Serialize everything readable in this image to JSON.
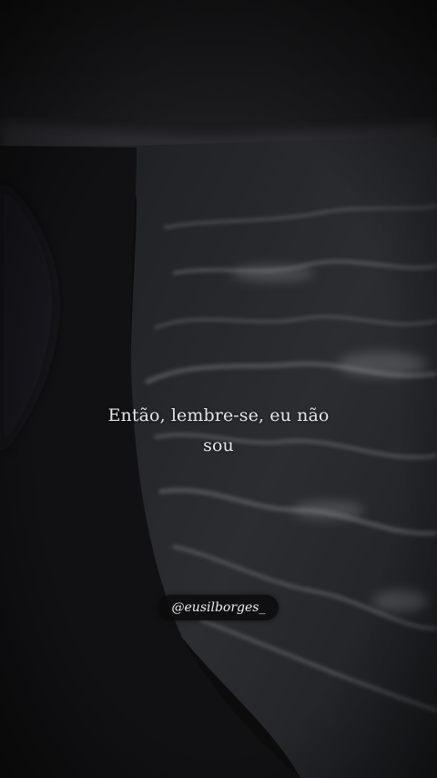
{
  "quote": {
    "line1": "Então, lembre-se, eu não",
    "line2": "sou"
  },
  "watermark": {
    "handle": "@eusilborges_"
  },
  "colors": {
    "sky": "#1a1a1c",
    "sea": "#2a2c30",
    "foam": "#6f7276",
    "sand": "#101012",
    "text": "#e6e6e6"
  }
}
